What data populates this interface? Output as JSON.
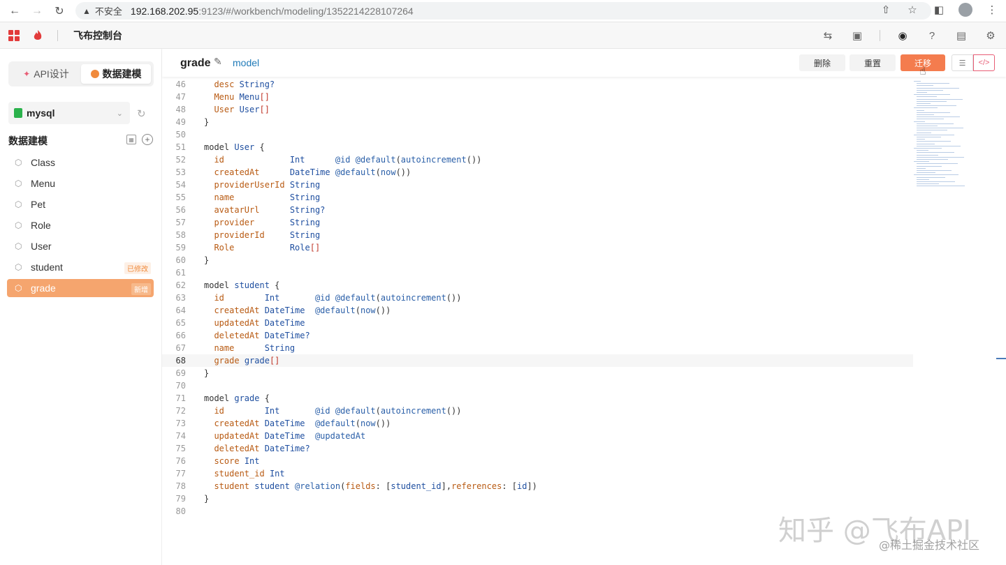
{
  "browser": {
    "security_warning": "不安全",
    "url_host": "192.168.202.95",
    "url_path": ":9123/#/workbench/modeling/1352214228107264"
  },
  "app": {
    "title": "飞布控制台",
    "brand_color": "#e23b3b"
  },
  "sidebar": {
    "tabs": [
      {
        "label": "API设计",
        "active": false
      },
      {
        "label": "数据建模",
        "active": true
      }
    ],
    "datasource": "mysql",
    "section_title": "数据建模",
    "models": [
      {
        "name": "Class",
        "badge": ""
      },
      {
        "name": "Menu",
        "badge": ""
      },
      {
        "name": "Pet",
        "badge": ""
      },
      {
        "name": "Role",
        "badge": ""
      },
      {
        "name": "User",
        "badge": ""
      },
      {
        "name": "student",
        "badge": "已修改"
      },
      {
        "name": "grade",
        "badge": "新增",
        "selected": true
      }
    ]
  },
  "main": {
    "model_name": "grade",
    "model_type": "model",
    "buttons": {
      "delete": "删除",
      "reset": "重置",
      "save": "迁移"
    },
    "accent_color": "#f47c4e"
  },
  "editor": {
    "current_line": 68,
    "lines": [
      {
        "n": 46,
        "t": [
          [
            "  ",
            "plain"
          ],
          [
            "desc ",
            "fld"
          ],
          [
            "String?",
            "typ"
          ]
        ]
      },
      {
        "n": 47,
        "t": [
          [
            "  ",
            "plain"
          ],
          [
            "Menu ",
            "fld"
          ],
          [
            "Menu",
            "typ"
          ],
          [
            "[]",
            "red"
          ]
        ]
      },
      {
        "n": 48,
        "t": [
          [
            "  ",
            "plain"
          ],
          [
            "User ",
            "fld"
          ],
          [
            "User",
            "typ"
          ],
          [
            "[]",
            "red"
          ]
        ]
      },
      {
        "n": 49,
        "t": [
          [
            "}",
            "plain"
          ]
        ]
      },
      {
        "n": 50,
        "t": []
      },
      {
        "n": 51,
        "t": [
          [
            "model ",
            "kw"
          ],
          [
            "User ",
            "typ"
          ],
          [
            "{",
            "plain"
          ]
        ]
      },
      {
        "n": 52,
        "t": [
          [
            "  ",
            "plain"
          ],
          [
            "id             ",
            "fld"
          ],
          [
            "Int      ",
            "typ"
          ],
          [
            "@id @default",
            "attr"
          ],
          [
            "(",
            "plain"
          ],
          [
            "autoincrement",
            "attr"
          ],
          [
            "())",
            "plain"
          ]
        ]
      },
      {
        "n": 53,
        "t": [
          [
            "  ",
            "plain"
          ],
          [
            "createdAt      ",
            "fld"
          ],
          [
            "DateTime ",
            "typ"
          ],
          [
            "@default",
            "attr"
          ],
          [
            "(",
            "plain"
          ],
          [
            "now",
            "attr"
          ],
          [
            "())",
            "plain"
          ]
        ]
      },
      {
        "n": 54,
        "t": [
          [
            "  ",
            "plain"
          ],
          [
            "providerUserId ",
            "fld"
          ],
          [
            "String",
            "typ"
          ]
        ]
      },
      {
        "n": 55,
        "t": [
          [
            "  ",
            "plain"
          ],
          [
            "name           ",
            "fld"
          ],
          [
            "String",
            "typ"
          ]
        ]
      },
      {
        "n": 56,
        "t": [
          [
            "  ",
            "plain"
          ],
          [
            "avatarUrl      ",
            "fld"
          ],
          [
            "String?",
            "typ"
          ]
        ]
      },
      {
        "n": 57,
        "t": [
          [
            "  ",
            "plain"
          ],
          [
            "provider       ",
            "fld"
          ],
          [
            "String",
            "typ"
          ]
        ]
      },
      {
        "n": 58,
        "t": [
          [
            "  ",
            "plain"
          ],
          [
            "providerId     ",
            "fld"
          ],
          [
            "String",
            "typ"
          ]
        ]
      },
      {
        "n": 59,
        "t": [
          [
            "  ",
            "plain"
          ],
          [
            "Role           ",
            "fld"
          ],
          [
            "Role",
            "typ"
          ],
          [
            "[]",
            "red"
          ]
        ]
      },
      {
        "n": 60,
        "t": [
          [
            "}",
            "plain"
          ]
        ]
      },
      {
        "n": 61,
        "t": []
      },
      {
        "n": 62,
        "t": [
          [
            "model ",
            "kw"
          ],
          [
            "student ",
            "typ"
          ],
          [
            "{",
            "plain"
          ]
        ]
      },
      {
        "n": 63,
        "t": [
          [
            "  ",
            "plain"
          ],
          [
            "id        ",
            "fld"
          ],
          [
            "Int       ",
            "typ"
          ],
          [
            "@id @default",
            "attr"
          ],
          [
            "(",
            "plain"
          ],
          [
            "autoincrement",
            "attr"
          ],
          [
            "())",
            "plain"
          ]
        ]
      },
      {
        "n": 64,
        "t": [
          [
            "  ",
            "plain"
          ],
          [
            "createdAt ",
            "fld"
          ],
          [
            "DateTime  ",
            "typ"
          ],
          [
            "@default",
            "attr"
          ],
          [
            "(",
            "plain"
          ],
          [
            "now",
            "attr"
          ],
          [
            "())",
            "plain"
          ]
        ]
      },
      {
        "n": 65,
        "t": [
          [
            "  ",
            "plain"
          ],
          [
            "updatedAt ",
            "fld"
          ],
          [
            "DateTime",
            "typ"
          ]
        ]
      },
      {
        "n": 66,
        "t": [
          [
            "  ",
            "plain"
          ],
          [
            "deletedAt ",
            "fld"
          ],
          [
            "DateTime?",
            "typ"
          ]
        ]
      },
      {
        "n": 67,
        "t": [
          [
            "  ",
            "plain"
          ],
          [
            "name      ",
            "fld"
          ],
          [
            "String",
            "typ"
          ]
        ]
      },
      {
        "n": 68,
        "t": [
          [
            "  ",
            "plain"
          ],
          [
            "grade ",
            "fld"
          ],
          [
            "grade",
            "typ"
          ],
          [
            "[]",
            "red"
          ]
        ]
      },
      {
        "n": 69,
        "t": [
          [
            "}",
            "plain"
          ]
        ]
      },
      {
        "n": 70,
        "t": []
      },
      {
        "n": 71,
        "t": [
          [
            "model ",
            "kw"
          ],
          [
            "grade ",
            "typ"
          ],
          [
            "{",
            "plain"
          ]
        ]
      },
      {
        "n": 72,
        "t": [
          [
            "  ",
            "plain"
          ],
          [
            "id        ",
            "fld"
          ],
          [
            "Int       ",
            "typ"
          ],
          [
            "@id @default",
            "attr"
          ],
          [
            "(",
            "plain"
          ],
          [
            "autoincrement",
            "attr"
          ],
          [
            "())",
            "plain"
          ]
        ]
      },
      {
        "n": 73,
        "t": [
          [
            "  ",
            "plain"
          ],
          [
            "createdAt ",
            "fld"
          ],
          [
            "DateTime  ",
            "typ"
          ],
          [
            "@default",
            "attr"
          ],
          [
            "(",
            "plain"
          ],
          [
            "now",
            "attr"
          ],
          [
            "())",
            "plain"
          ]
        ]
      },
      {
        "n": 74,
        "t": [
          [
            "  ",
            "plain"
          ],
          [
            "updatedAt ",
            "fld"
          ],
          [
            "DateTime  ",
            "typ"
          ],
          [
            "@updatedAt",
            "attr"
          ]
        ]
      },
      {
        "n": 75,
        "t": [
          [
            "  ",
            "plain"
          ],
          [
            "deletedAt ",
            "fld"
          ],
          [
            "DateTime?",
            "typ"
          ]
        ]
      },
      {
        "n": 76,
        "t": [
          [
            "  ",
            "plain"
          ],
          [
            "score ",
            "fld"
          ],
          [
            "Int",
            "typ"
          ]
        ]
      },
      {
        "n": 77,
        "t": [
          [
            "  ",
            "plain"
          ],
          [
            "student_id ",
            "fld"
          ],
          [
            "Int",
            "typ"
          ]
        ]
      },
      {
        "n": 78,
        "t": [
          [
            "  ",
            "plain"
          ],
          [
            "student ",
            "fld"
          ],
          [
            "student ",
            "typ"
          ],
          [
            "@relation",
            "attr"
          ],
          [
            "(",
            "plain"
          ],
          [
            "fields",
            "fld"
          ],
          [
            ": [",
            "plain"
          ],
          [
            "student_id",
            "typ"
          ],
          [
            "],",
            "plain"
          ],
          [
            "references",
            "fld"
          ],
          [
            ": [",
            "plain"
          ],
          [
            "id",
            "typ"
          ],
          [
            "])",
            "plain"
          ]
        ]
      },
      {
        "n": 79,
        "t": [
          [
            "}",
            "plain"
          ]
        ]
      },
      {
        "n": 80,
        "t": []
      }
    ]
  },
  "watermark": {
    "line1": "知乎 @飞布API",
    "line2": "@稀土掘金技术社区"
  }
}
